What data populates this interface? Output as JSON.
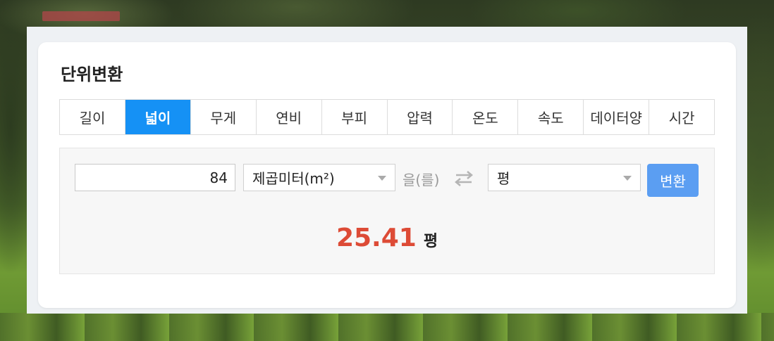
{
  "converter": {
    "title": "단위변환",
    "tabs": [
      {
        "label": "길이",
        "active": false
      },
      {
        "label": "넓이",
        "active": true
      },
      {
        "label": "무게",
        "active": false
      },
      {
        "label": "연비",
        "active": false
      },
      {
        "label": "부피",
        "active": false
      },
      {
        "label": "압력",
        "active": false
      },
      {
        "label": "온도",
        "active": false
      },
      {
        "label": "속도",
        "active": false
      },
      {
        "label": "데이터양",
        "active": false
      },
      {
        "label": "시간",
        "active": false
      }
    ],
    "input_value": "84",
    "from_unit": "제곱미터(m²)",
    "connector": "을(를)",
    "to_unit": "평",
    "convert_label": "변환",
    "result_value": "25.41",
    "result_unit": "평"
  },
  "colors": {
    "accent": "#1591f5",
    "button": "#5b9ef2",
    "result": "#dd4b36"
  },
  "icons": {
    "swap": "swap-arrows-icon",
    "dropdown": "chevron-down-icon"
  }
}
